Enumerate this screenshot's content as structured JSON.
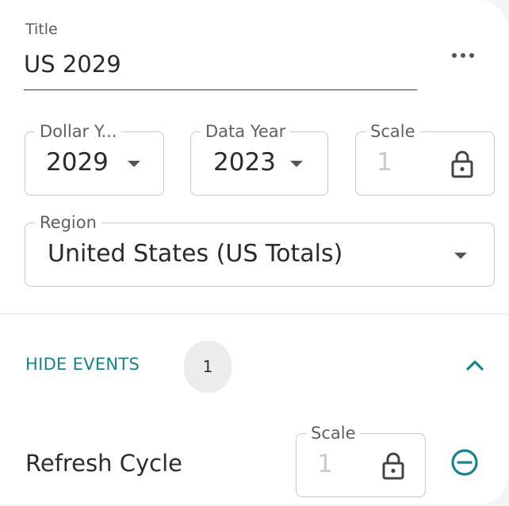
{
  "title": {
    "label": "Title",
    "value": "US 2029"
  },
  "dollar_year": {
    "label": "Dollar Y...",
    "value": "2029"
  },
  "data_year": {
    "label": "Data Year",
    "value": "2023"
  },
  "scale": {
    "label": "Scale",
    "value": "1"
  },
  "region": {
    "label": "Region",
    "value": "United States (US Totals)"
  },
  "events": {
    "toggle_label": "HIDE EVENTS",
    "count": "1",
    "items": [
      {
        "name": "Refresh Cycle",
        "scale_label": "Scale",
        "scale_value": "1"
      }
    ]
  },
  "icons": [
    "more-horizontal-icon",
    "caret-down-icon",
    "lock-icon",
    "chevron-up-icon",
    "minus-circle-icon"
  ],
  "colors": {
    "accent": "#17838a",
    "border": "#c9c9c9"
  }
}
